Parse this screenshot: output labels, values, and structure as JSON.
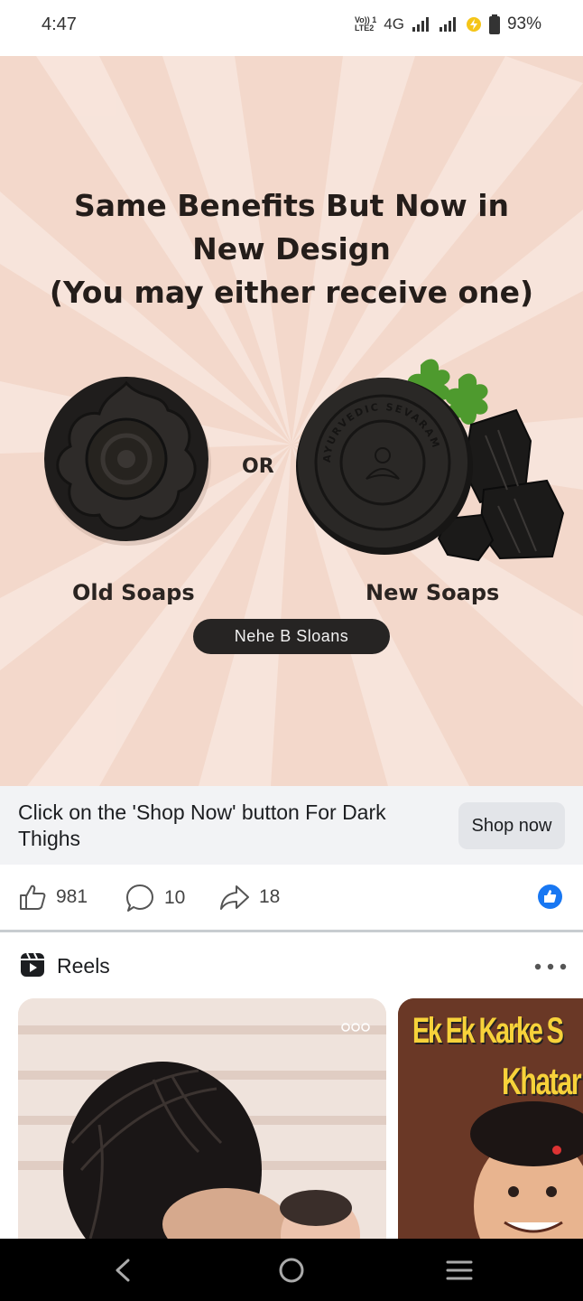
{
  "status_bar": {
    "time": "4:47",
    "network_label_top": "Vo)) 1",
    "network_label_bottom": "LTE2",
    "network_type": "4G",
    "battery_percent": "93%"
  },
  "ad": {
    "headline_line1": "Same Benefits But Now in",
    "headline_line2": "New Design",
    "headline_line3": "(You may either receive one)",
    "or_label": "OR",
    "old_label": "Old Soaps",
    "new_label": "New Soaps",
    "pill_label": "Nehe B Sloans",
    "soap_stamp_text": "AYURVEDIC SEVARAM",
    "background_color": "#f4dcd0"
  },
  "cta": {
    "text": "Click on the 'Shop Now' button For Dark Thighs",
    "button_label": "Shop now"
  },
  "engagement": {
    "likes": "981",
    "comments": "10",
    "shares": "18",
    "accent_color": "#1877f2"
  },
  "reels": {
    "title": "Reels",
    "reel2_caption_line1": "Ek Ek Karke S",
    "reel2_caption_line2": "Khatar"
  },
  "icons": {
    "like": "thumbs-up-icon",
    "comment": "comment-icon",
    "share": "share-icon",
    "reels": "reels-icon",
    "nav_back": "back-icon",
    "nav_home": "home-icon",
    "nav_menu": "menu-icon"
  }
}
